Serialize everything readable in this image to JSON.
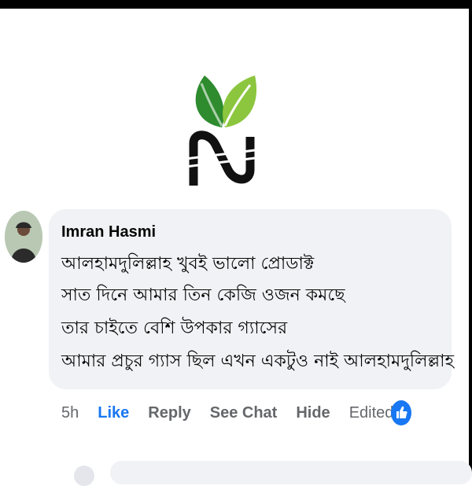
{
  "logo": {
    "icon": "leaf-n-logo-icon"
  },
  "comment": {
    "author": "Imran Hasmi",
    "lines": [
      "আলহামদুলিল্লাহ খুবই ভালো প্রোডাক্ট",
      "সাত দিনে আমার তিন কেজি ওজন কমছে",
      "তার চাইতে বেশি উপকার গ্যাসের",
      "আমার প্রচুর গ্যাস ছিল এখন একটুও নাই আলহামদুলিল্লাহ"
    ]
  },
  "actions": {
    "time": "5h",
    "like": "Like",
    "reply": "Reply",
    "see_chat": "See Chat",
    "hide": "Hide",
    "edited": "Edited",
    "reaction_icon": "like-thumb-icon"
  },
  "colors": {
    "like_blue": "#1877f2",
    "bubble_bg": "#f0f2f5",
    "muted_text": "#65676b",
    "leaf_dark": "#2e8b2e",
    "leaf_light": "#8cc63f"
  }
}
